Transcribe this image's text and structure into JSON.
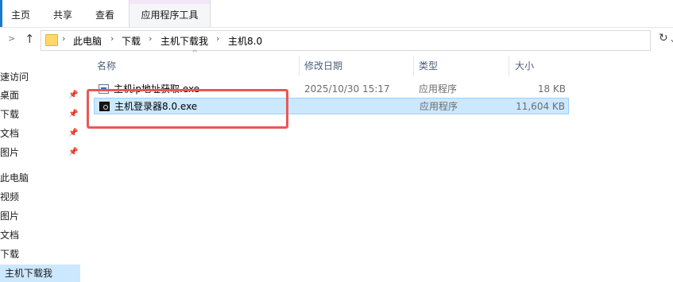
{
  "ribbon": {
    "tabs": [
      "主页",
      "共享",
      "查看",
      "应用程序工具"
    ],
    "accent_color": "#1979ca"
  },
  "address": {
    "back_icon": "chevron-right-icon",
    "up_icon": "up-arrow-icon",
    "crumbs": [
      "此电脑",
      "下载",
      "主机下载我",
      "主机8.0"
    ],
    "separator": "›",
    "dropdown_icon": "chevron-down-icon",
    "refresh_icon": "refresh-icon"
  },
  "sidebar": {
    "items": [
      {
        "label": "速访问",
        "pinned": false
      },
      {
        "label": "桌面",
        "pinned": true
      },
      {
        "label": "下载",
        "pinned": true
      },
      {
        "label": "文档",
        "pinned": true
      },
      {
        "label": "图片",
        "pinned": true
      },
      {
        "label": "此电脑",
        "pinned": false
      },
      {
        "label": "视频",
        "pinned": false
      },
      {
        "label": "图片",
        "pinned": false
      },
      {
        "label": "文档",
        "pinned": false
      },
      {
        "label": "下载",
        "pinned": false
      },
      {
        "label": "主机下载我",
        "pinned": false
      }
    ],
    "pin_glyph": "📌"
  },
  "columns": {
    "name": "名称",
    "date": "修改日期",
    "type": "类型",
    "size": "大小",
    "sort_glyph": "^"
  },
  "files": [
    {
      "name": "主机ip地址获取.exe",
      "date": "2025/10/30 15:17",
      "type": "应用程序",
      "size": "18 KB",
      "icon": "app-exe-icon"
    },
    {
      "name": "主机登录器8.0.exe",
      "date": "",
      "type": "应用程序",
      "size": "11,604 KB",
      "icon": "dark-exe-icon",
      "selected": true
    }
  ],
  "annotation_color": "#e85855",
  "selection_color": "#cce8ff"
}
